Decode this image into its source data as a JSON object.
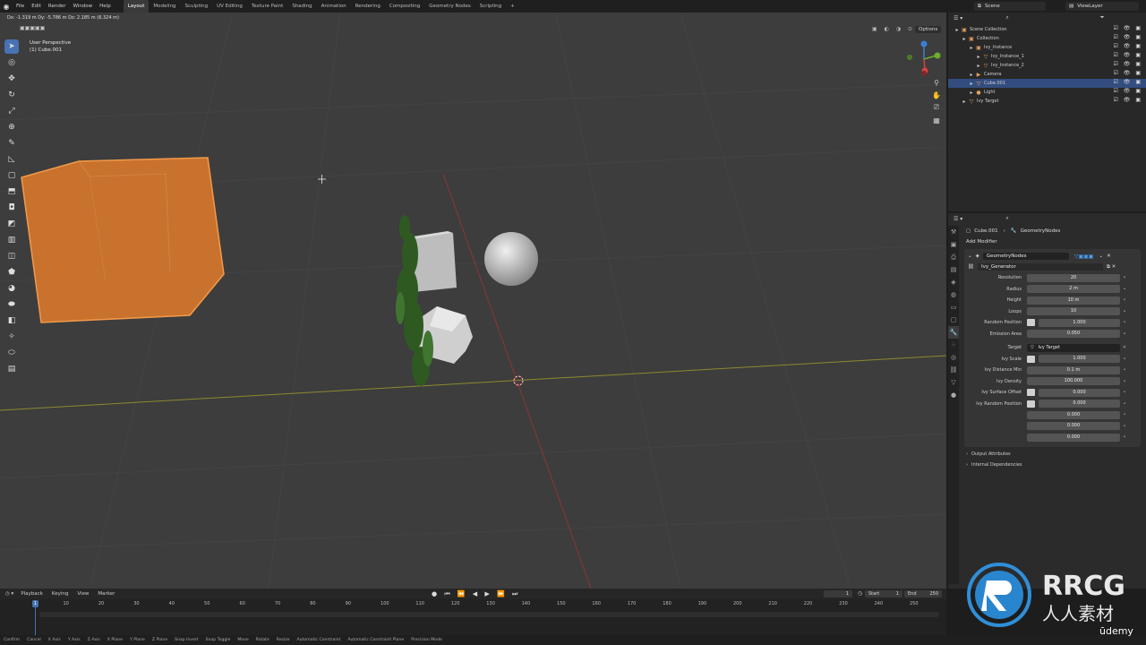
{
  "topbar": {
    "menus": [
      "File",
      "Edit",
      "Render",
      "Window",
      "Help"
    ],
    "workspaces": [
      "Layout",
      "Modeling",
      "Sculpting",
      "UV Editing",
      "Texture Paint",
      "Shading",
      "Animation",
      "Rendering",
      "Compositing",
      "Geometry Nodes",
      "Scripting",
      "+"
    ],
    "active_workspace": "Layout",
    "scene": "Scene",
    "view_layer": "ViewLayer"
  },
  "viewport": {
    "status_line": "Dx: -1.319 m  Dy: -5.786 m  Dz: 2.185 m (6.324 m)",
    "perspective": "User Perspective",
    "active_object": "(1) Cube.001",
    "options_label": "Options",
    "header_icons": "▣ ◐ ◑ ⊙",
    "gizmo_axes": [
      "X",
      "Y",
      "Z"
    ],
    "toolbar_icons": [
      "cursor-select",
      "cursor",
      "move",
      "rotate",
      "scale",
      "transform",
      "annotate",
      "measure",
      "add-cube",
      "extrude",
      "inset",
      "bevel",
      "loop-cut",
      "knife",
      "poly-build",
      "spin",
      "smooth",
      "edge-slide",
      "shrink",
      "shear",
      "rip"
    ]
  },
  "outliner": {
    "items": [
      {
        "label": "Scene Collection",
        "indent": 0,
        "icon": "▣"
      },
      {
        "label": "Collection",
        "indent": 1,
        "icon": "▣"
      },
      {
        "label": "Ivy_Instance",
        "indent": 2,
        "icon": "▣"
      },
      {
        "label": "Ivy_Instance_1",
        "indent": 3,
        "icon": "▽"
      },
      {
        "label": "Ivy_Instance_2",
        "indent": 3,
        "icon": "▽"
      },
      {
        "label": "Camera",
        "indent": 2,
        "icon": "▶"
      },
      {
        "label": "Cube.001",
        "indent": 2,
        "icon": "▽",
        "selected": true
      },
      {
        "label": "Light",
        "indent": 2,
        "icon": "●"
      },
      {
        "label": "Ivy Target",
        "indent": 1,
        "icon": "▽"
      }
    ]
  },
  "properties": {
    "object_name": "Cube.001",
    "modifier_crumb": "GeometryNodes",
    "add_modifier": "Add Modifier",
    "modifier_name": "GeometryNodes",
    "node_group": "Ivy_Generator",
    "fields": [
      {
        "label": "Resolution",
        "value": "20"
      },
      {
        "label": "Radius",
        "value": "2 m"
      },
      {
        "label": "Height",
        "value": "10 m"
      },
      {
        "label": "Loops",
        "value": "10"
      },
      {
        "label": "Random Position",
        "value": "1.000",
        "check": true
      },
      {
        "label": "Emission Area",
        "value": "0.050"
      }
    ],
    "target_label": "Target",
    "target_value": "Ivy Target",
    "fields2": [
      {
        "label": "Ivy Scale",
        "value": "1.000",
        "check": true
      },
      {
        "label": "Ivy Distance Min",
        "value": "0.1 m"
      },
      {
        "label": "Ivy Density",
        "value": "100.000"
      },
      {
        "label": "Ivy Surface Offset",
        "value": "0.000",
        "check": true
      },
      {
        "label": "Ivy Random Position",
        "value": "0.000",
        "check": true
      },
      {
        "label": "",
        "value": "0.000"
      },
      {
        "label": "",
        "value": "0.000"
      },
      {
        "label": "",
        "value": "0.000"
      }
    ],
    "sub_panels": [
      "Output Attributes",
      "Internal Dependencies"
    ]
  },
  "timeline": {
    "menus": [
      "Playback",
      "Keying",
      "View",
      "Marker"
    ],
    "current_frame": "1",
    "start_label": "Start",
    "start": "1",
    "end_label": "End",
    "end": "250",
    "ticks": [
      "1",
      "10",
      "20",
      "30",
      "40",
      "50",
      "60",
      "70",
      "80",
      "90",
      "100",
      "110",
      "120",
      "130",
      "140",
      "150",
      "160",
      "170",
      "180",
      "190",
      "200",
      "210",
      "220",
      "230",
      "240",
      "250"
    ]
  },
  "statusbar": {
    "items": [
      "Confirm",
      "Cancel",
      "X Axis",
      "Y Axis",
      "Z Axis",
      "X Plane",
      "Y Plane",
      "Z Plane",
      "Snap Invert",
      "Snap Toggle",
      "Move",
      "Rotate",
      "Resize",
      "Automatic Constraint",
      "Automatic Constraint Plane",
      "Precision Mode"
    ]
  },
  "watermark": {
    "brand": "RRCG",
    "sub": "人人素材",
    "udemy": "ūdemy"
  },
  "colors": {
    "accent": "#4772b3",
    "selected_object": "#e0833a",
    "viewport_bg": "#3d3d3d"
  }
}
